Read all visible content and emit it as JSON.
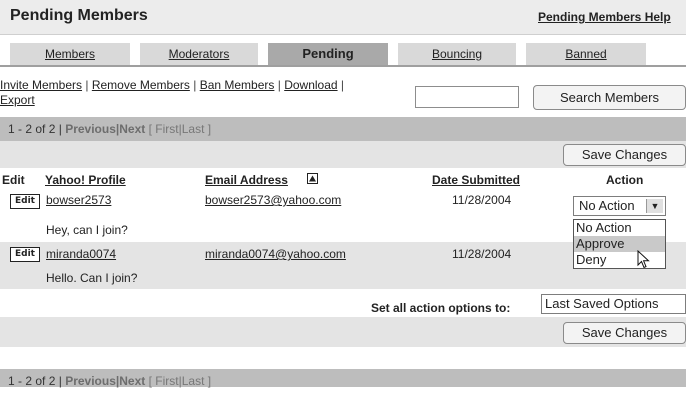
{
  "header": {
    "title": "Pending Members",
    "help_link": "Pending Members Help"
  },
  "tabs": [
    {
      "label": "Members",
      "active": false
    },
    {
      "label": "Moderators",
      "active": false
    },
    {
      "label": "Pending",
      "active": true
    },
    {
      "label": "Bouncing",
      "active": false
    },
    {
      "label": "Banned",
      "active": false
    }
  ],
  "actions": {
    "invite": "Invite Members",
    "remove": "Remove Members",
    "ban": "Ban Members",
    "download": "Download",
    "export": "Export",
    "sep": "|",
    "search_value": "",
    "search_button": "Search Members"
  },
  "pager": {
    "range": "1 - 2 of 2",
    "sep": "|",
    "previous": "Previous",
    "next": "Next",
    "open_bracket": "[",
    "first": "First",
    "last": "Last",
    "close_bracket": "]"
  },
  "buttons": {
    "save_changes": "Save Changes"
  },
  "table": {
    "headers": {
      "edit": "Edit",
      "profile": "Yahoo! Profile",
      "email": "Email Address",
      "date": "Date Submitted",
      "action": "Action"
    },
    "sort_indicator": "▲",
    "edit_badge": "Edit",
    "rows": [
      {
        "profile": "bowser2573",
        "email": "bowser2573@yahoo.com",
        "date": "11/28/2004",
        "message": "Hey, can I join?",
        "action": "No Action"
      },
      {
        "profile": "miranda0074",
        "email": "miranda0074@yahoo.com",
        "date": "11/28/2004",
        "message": "Hello. Can I join?",
        "action": ""
      }
    ]
  },
  "dropdown": {
    "options": [
      "No Action",
      "Approve",
      "Deny"
    ],
    "highlighted": "Approve"
  },
  "set_all": {
    "label": "Set all action options to:",
    "value": "Last Saved Options"
  },
  "colors": {
    "header_bg": "#ececec",
    "tab_bg": "#d9d9d9",
    "tab_active_bg": "#a9a9a9",
    "pager_bg": "#bdbdbd",
    "row_alt_bg": "#e4e4e4"
  },
  "icons": {
    "select_arrow": "chevron-down-icon",
    "sort": "sort-ascending-icon",
    "pointer": "mouse-pointer-icon"
  }
}
